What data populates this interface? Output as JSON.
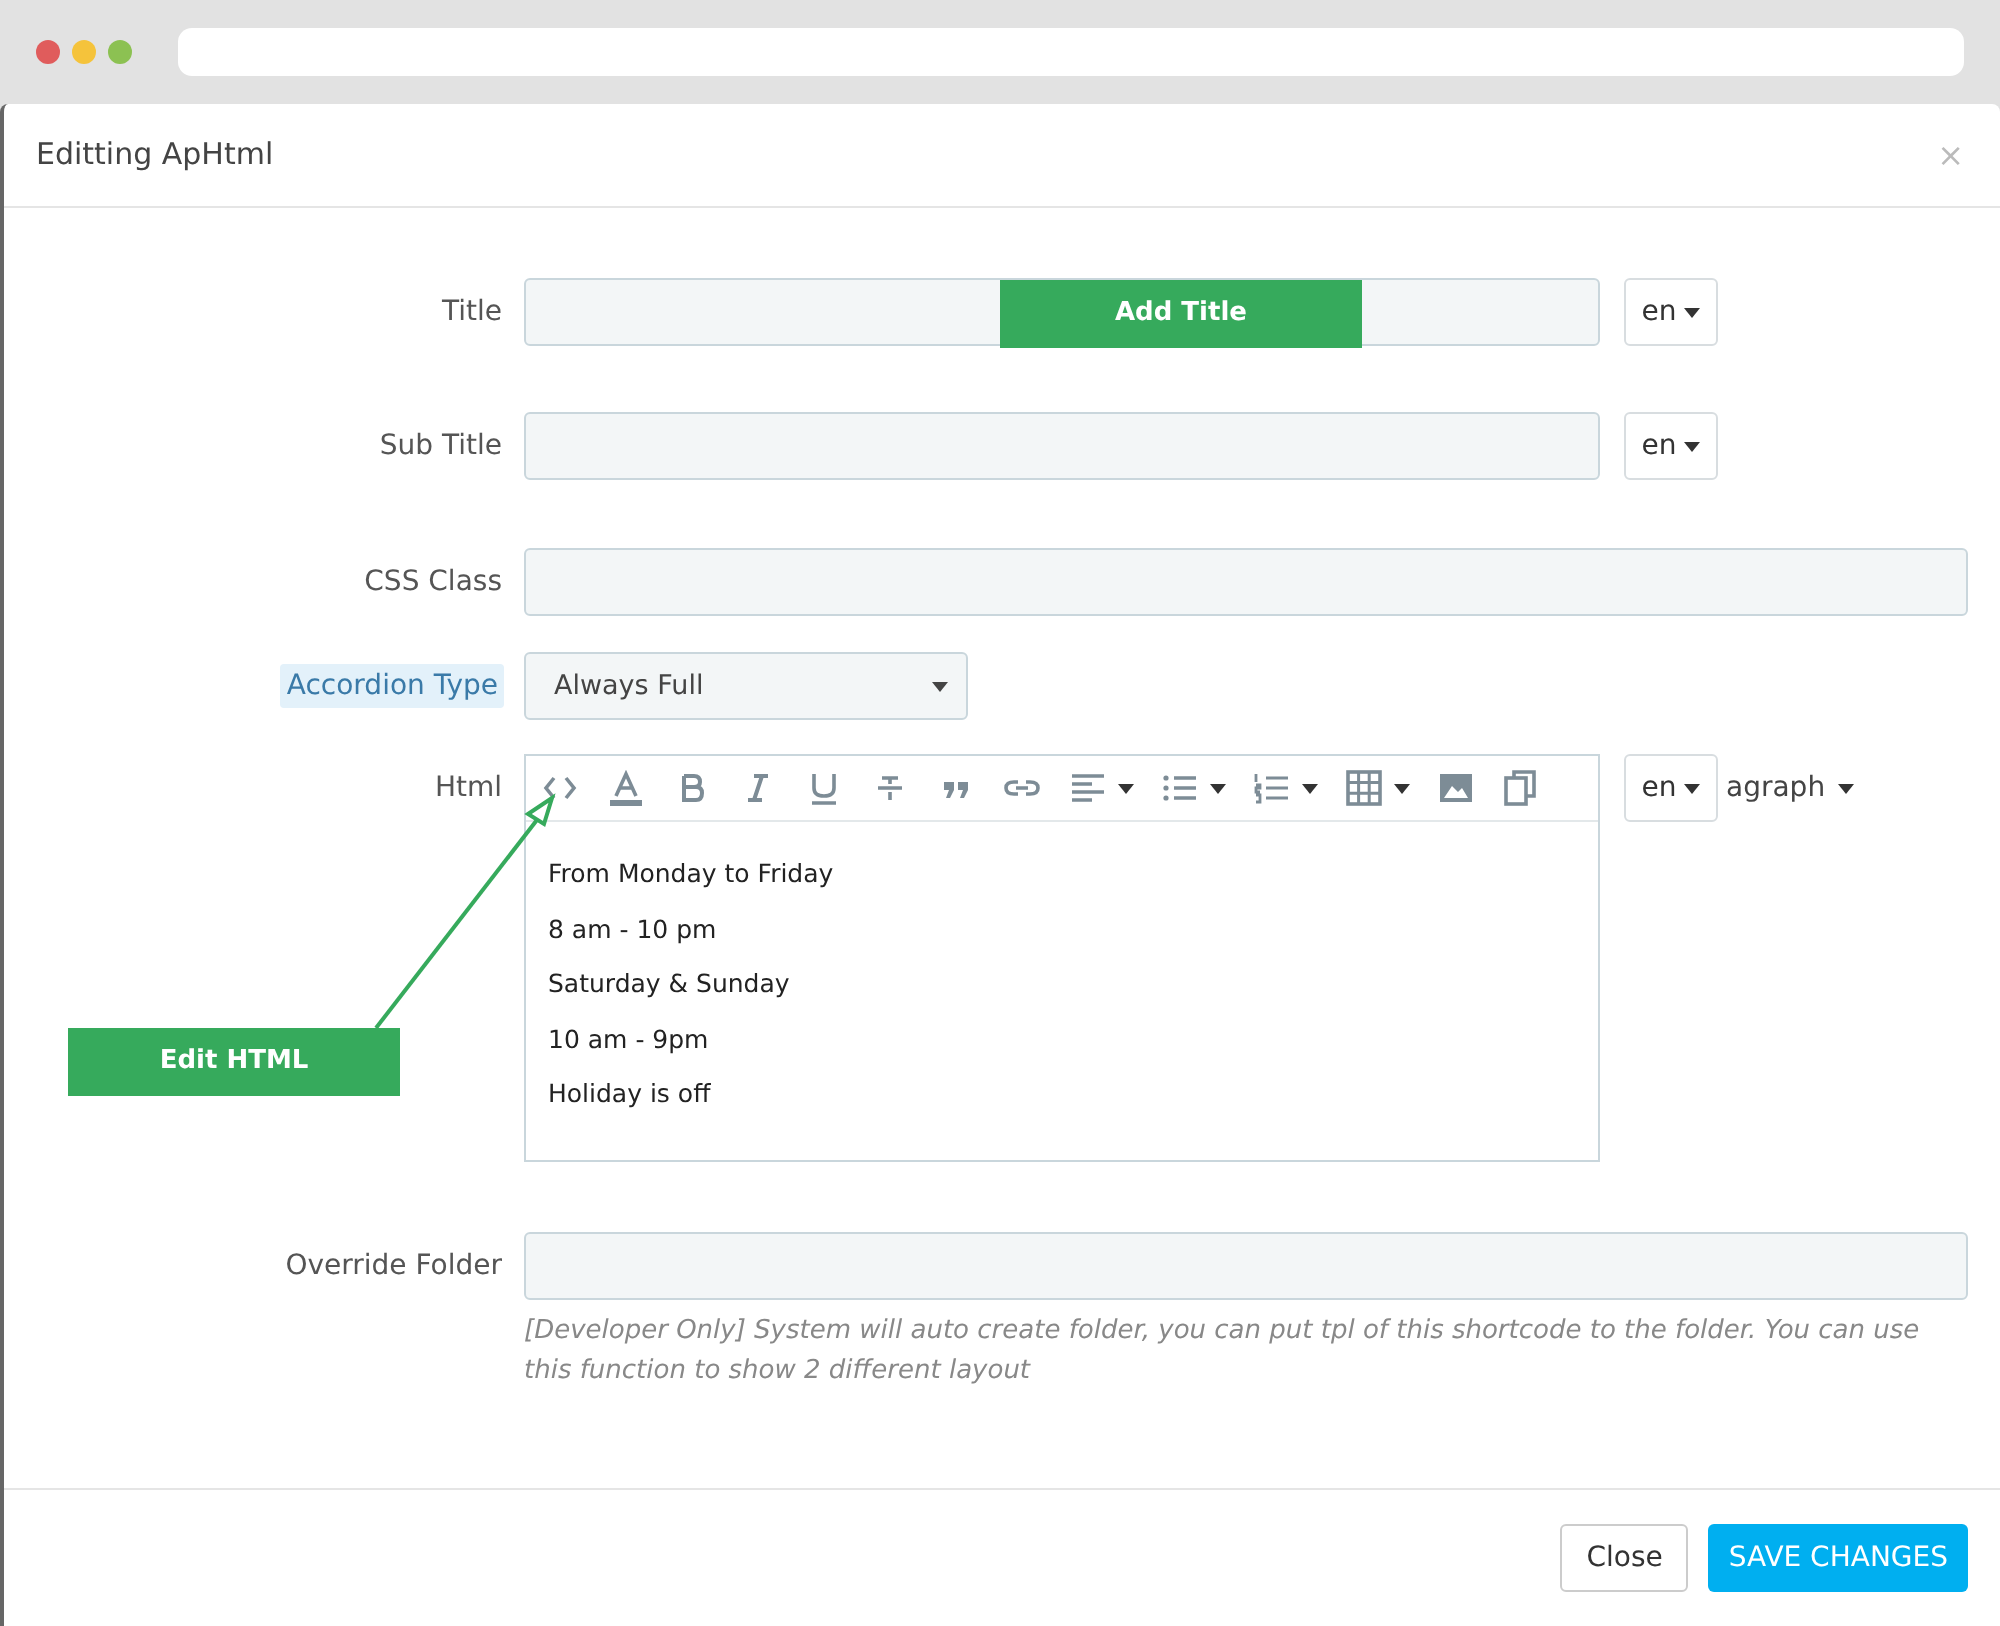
{
  "modal": {
    "title": "Editting ApHtml",
    "close": "×"
  },
  "fields": [
    {
      "kind": "input",
      "label": "Title",
      "lang": "en",
      "highlighted": false
    },
    {
      "kind": "input",
      "label": "Sub Title",
      "lang": "en",
      "highlighted": false
    },
    {
      "kind": "input",
      "label": "CSS Class",
      "highlighted": false
    },
    {
      "kind": "select",
      "label": "Accordion Type",
      "value": "Always Full",
      "highlighted": true
    },
    {
      "kind": "editor",
      "label": "Html",
      "lang": "en",
      "format_label": "agraph",
      "highlighted": false,
      "lines": [
        "From Monday to Friday",
        "8 am - 10 pm",
        "Saturday & Sunday",
        "10 am - 9pm",
        "Holiday is off"
      ]
    },
    {
      "kind": "input",
      "label": "Override Folder",
      "highlighted": false,
      "help": "[Developer Only] System will auto create folder, you can put tpl of this shortcode to the folder. You can use this function to show 2 different layout"
    }
  ],
  "annotations": [
    {
      "text": "Add Title"
    },
    {
      "text": "Edit HTML"
    }
  ],
  "footer": {
    "buttons": [
      {
        "label": "Close",
        "kind": "secondary"
      },
      {
        "label": "SAVE CHANGES",
        "kind": "primary"
      }
    ]
  }
}
